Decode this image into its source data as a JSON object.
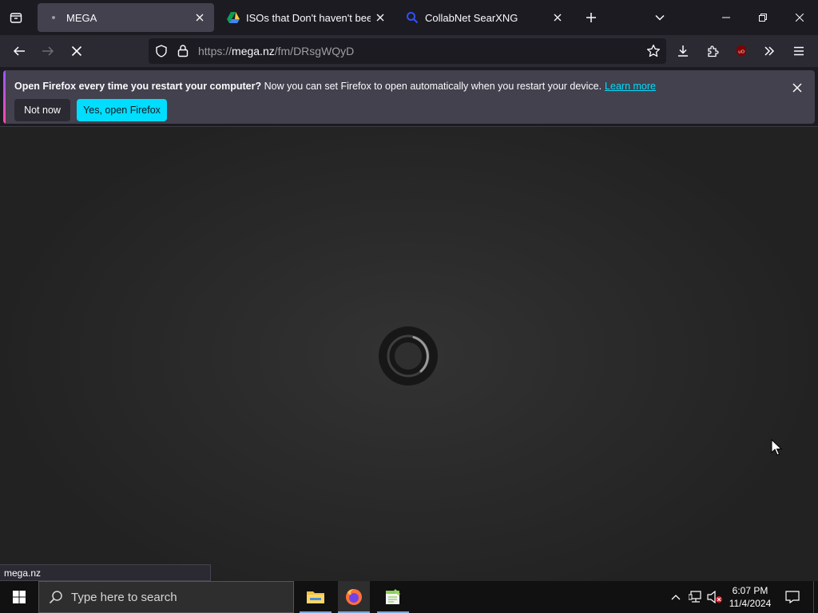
{
  "tabs": [
    {
      "title": "MEGA",
      "active": true,
      "favicon": "mega-dot"
    },
    {
      "title": "ISOs that Don't haven't been up",
      "active": false,
      "favicon": "google-drive-icon"
    },
    {
      "title": "CollabNet SearXNG",
      "active": false,
      "favicon": "search-icon"
    }
  ],
  "navbar": {
    "url_prefix": "https://",
    "url_host": "mega.nz",
    "url_path": "/fm/DRsgWQyD"
  },
  "notification": {
    "bold": "Open Firefox every time you restart your computer?",
    "text": "Now you can set Firefox to open automatically when you restart your device.",
    "link": "Learn more",
    "button_secondary": "Not now",
    "button_primary": "Yes, open Firefox"
  },
  "status_bar": "mega.nz",
  "taskbar": {
    "search_placeholder": "Type here to search",
    "time": "6:07 PM",
    "date": "11/4/2024"
  },
  "colors": {
    "accent": "#00ddff",
    "tab_active": "#42414d",
    "toolbar": "#2b2a33"
  }
}
